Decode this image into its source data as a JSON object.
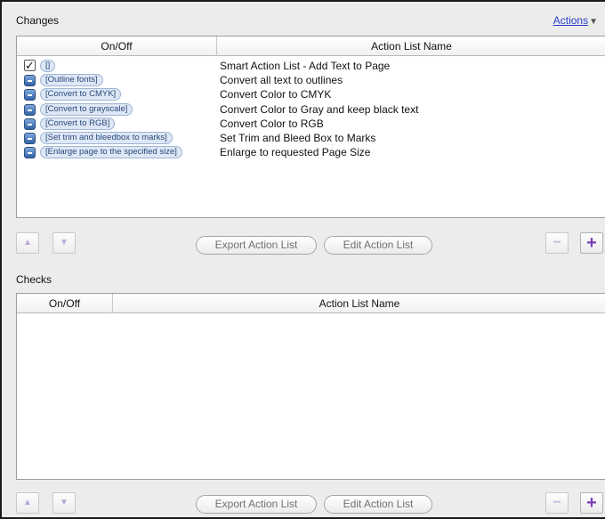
{
  "changes": {
    "title": "Changes",
    "actions_label": "Actions",
    "columns": {
      "onoff": "On/Off",
      "name": "Action List Name"
    },
    "rows": [
      {
        "control": "checkbox",
        "checked": true,
        "tag": "[]",
        "name": "Smart Action List - Add Text to Page"
      },
      {
        "control": "toggle",
        "tag": "[Outline fonts]",
        "name": "Convert all text to outlines"
      },
      {
        "control": "toggle",
        "tag": "[Convert to CMYK]",
        "name": "Convert Color to CMYK"
      },
      {
        "control": "toggle",
        "tag": "[Convert to grayscale]",
        "name": "Convert Color to Gray and keep black text"
      },
      {
        "control": "toggle",
        "tag": "[Convert to RGB]",
        "name": "Convert Color to RGB"
      },
      {
        "control": "toggle",
        "tag": "[Set trim and bleedbox to marks]",
        "name": "Set Trim and Bleed Box to Marks"
      },
      {
        "control": "toggle",
        "tag": "[Enlarge page to the specified size]",
        "name": "Enlarge to requested Page Size"
      }
    ],
    "toolbar": {
      "export_label": "Export Action List",
      "edit_label": "Edit Action List"
    }
  },
  "checks": {
    "title": "Checks",
    "columns": {
      "onoff": "On/Off",
      "name": "Action List Name"
    },
    "rows": [],
    "toolbar": {
      "export_label": "Export Action List",
      "edit_label": "Edit Action List"
    }
  },
  "icons": {
    "move_up": "up-triangle-icon",
    "move_down": "down-triangle-icon",
    "remove": "minus-icon",
    "add": "plus-icon",
    "actions_menu": "dropdown-caret-icon"
  },
  "colors": {
    "link": "#2a3fc9",
    "add_button": "#7a3fb5",
    "tag_bg": "#dde7f5",
    "toggle": "#2f62a8"
  }
}
